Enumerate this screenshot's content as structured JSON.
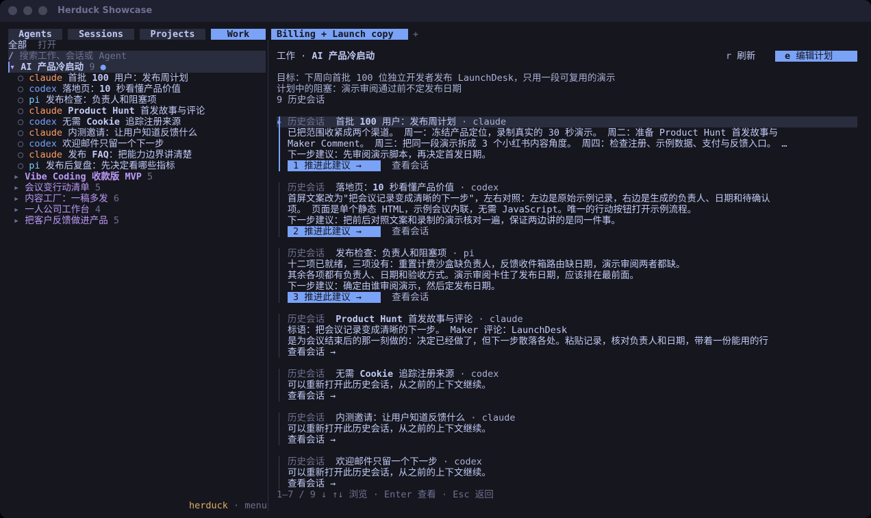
{
  "window": {
    "title": "Herduck Showcase"
  },
  "tabs": [
    {
      "label": "Agents",
      "active": false
    },
    {
      "label": "Sessions",
      "active": false
    },
    {
      "label": "Projects",
      "active": false
    },
    {
      "label": "Work",
      "active": true
    },
    {
      "label": "Billing + Launch copy",
      "active": true
    }
  ],
  "tab_add": "+",
  "sidebar": {
    "filter_all": "全部",
    "filter_open": "打开",
    "search_prefix": "/",
    "search_placeholder": "搜索工作、会话或 Agent",
    "active_project": {
      "arrow": "▾",
      "name": "AI 产品冷启动",
      "count": "9",
      "dot": "●"
    },
    "sessions": [
      {
        "bullet": "○",
        "agent": "claude",
        "pre": "首批 ",
        "bold": "100",
        "post": " 用户：发布周计划"
      },
      {
        "bullet": "○",
        "agent": "codex",
        "pre": "落地页：",
        "bold": "10",
        "post": " 秒看懂产品价值"
      },
      {
        "bullet": "○",
        "agent": "pi",
        "pre": "发布检查：负责人和阻塞项",
        "bold": "",
        "post": ""
      },
      {
        "bullet": "○",
        "agent": "claude",
        "pre": "",
        "bold": "Product Hunt",
        "post": " 首发故事与评论"
      },
      {
        "bullet": "○",
        "agent": "codex",
        "pre": "无需 ",
        "bold": "Cookie",
        "post": " 追踪注册来源"
      },
      {
        "bullet": "○",
        "agent": "claude",
        "pre": "内测邀请：让用户知道反馈什么",
        "bold": "",
        "post": ""
      },
      {
        "bullet": "○",
        "agent": "codex",
        "pre": "欢迎邮件只留一个下一步",
        "bold": "",
        "post": ""
      },
      {
        "bullet": "○",
        "agent": "claude",
        "pre": "发布 ",
        "bold": "FAQ",
        "post": "：把能力边界讲清楚"
      },
      {
        "bullet": "○",
        "agent": "pi",
        "pre": "发布后复盘：先决定看哪些指标",
        "bold": "",
        "post": ""
      }
    ],
    "projects": [
      {
        "arrow": "▸",
        "pre": "Vibe Coding 收款版 ",
        "bold": "MVP",
        "count": "5"
      },
      {
        "arrow": "▸",
        "pre": "会议变行动清单",
        "bold": "",
        "count": "5"
      },
      {
        "arrow": "▸",
        "pre": "内容工厂：一稿多发",
        "bold": "",
        "count": "6"
      },
      {
        "arrow": "▸",
        "pre": "一人公司工作台",
        "bold": "",
        "count": "4"
      },
      {
        "arrow": "▸",
        "pre": "把客户反馈做进产品",
        "bold": "",
        "count": "5"
      }
    ],
    "footer_brand": "herduck",
    "footer_sep": "·",
    "footer_menu": "menu"
  },
  "main": {
    "header_prefix": "工作 · ",
    "header_project": "AI 产品冷启动",
    "refresh_key": "r",
    "refresh_label": "刷新",
    "edit_key": "e",
    "edit_label": "编辑计划",
    "goal": "目标：下周向首批 100 位独立开发者发布 LaunchDesk，只用一段可复用的演示",
    "blocker": "计划中的阻塞：演示审阅通过前不定发布日期",
    "history_count": "9 历史会话",
    "cards": [
      {
        "tag": "历史会话",
        "title_pre": "首批 ",
        "title_bold": "100",
        "title_post": " 用户：发布周计划",
        "agent": "claude",
        "lines": [
          "已把范围收紧成两个渠道。 周一：冻结产品定位，录制真实的 30 秒演示。 周二：准备 Product Hunt 首发故事与",
          "Maker Comment。 周三：把同一段演示拆成 3 个小红书内容角度。 周四：检查注册、示例数据、支付与反馈入口。 …",
          "下一步建议：先审阅演示脚本，再决定首发日期。"
        ],
        "advance_label": "1 推进此建议 →",
        "view_label": "查看会话"
      },
      {
        "tag": "历史会话",
        "title_pre": "落地页：",
        "title_bold": "10",
        "title_post": " 秒看懂产品价值",
        "agent": "codex",
        "lines": [
          "首屏文案改为\"把会议记录变成清晰的下一步\"，左右对照：左边是原始示例记录，右边是生成的负责人、日期和待确认",
          "项。 页面是单个静态 HTML，示例会议内联，无需 JavaScript。唯一的行动按钮打开示例流程。",
          "下一步建议：把前后对照文案和录制的演示核对一遍，保证两边讲的是同一件事。"
        ],
        "advance_label": "2 推进此建议 →",
        "view_label": "查看会话"
      },
      {
        "tag": "历史会话",
        "title_pre": "发布检查：负责人和阻塞项",
        "title_bold": "",
        "title_post": "",
        "agent": "pi",
        "lines": [
          "十二项已就绪，三项没有：重置计费沙盒缺负责人，反馈收件箱路由缺日期，演示审阅两者都缺。",
          "其余各项都有负责人、日期和验收方式。演示审阅卡住了发布日期，应该排在最前面。",
          "下一步建议：确定由谁审阅演示，然后定发布日期。"
        ],
        "advance_label": "3 推进此建议 →",
        "view_label": "查看会话"
      },
      {
        "tag": "历史会话",
        "title_pre": "",
        "title_bold": "Product Hunt",
        "title_post": " 首发故事与评论",
        "agent": "claude",
        "lines": [
          "标语：把会议记录变成清晰的下一步。 Maker 评论：LaunchDesk",
          "是为会议结束后的那一刻做的：决定已经做了，但下一步散落各处。粘贴记录，核对负责人和日期，带着一份能用的行"
        ],
        "advance_label": "",
        "view_label": "查看会话 →"
      },
      {
        "tag": "历史会话",
        "title_pre": "无需 ",
        "title_bold": "Cookie",
        "title_post": " 追踪注册来源",
        "agent": "codex",
        "lines": [
          "可以重新打开此历史会话，从之前的上下文继续。"
        ],
        "advance_label": "",
        "view_label": "查看会话 →"
      },
      {
        "tag": "历史会话",
        "title_pre": "内测邀请：让用户知道反馈什么",
        "title_bold": "",
        "title_post": "",
        "agent": "claude",
        "lines": [
          "可以重新打开此历史会话，从之前的上下文继续。"
        ],
        "advance_label": "",
        "view_label": "查看会话 →"
      },
      {
        "tag": "历史会话",
        "title_pre": "欢迎邮件只留一个下一步",
        "title_bold": "",
        "title_post": "",
        "agent": "codex",
        "lines": [
          "可以重新打开此历史会话，从之前的上下文继续。"
        ],
        "advance_label": "",
        "view_label": "查看会话 →"
      }
    ],
    "selected_marker": "▸",
    "agent_sep": "·",
    "status_bar": "1–7 / 9 ↓  ↑↓ 浏览 · Enter 查看 · Esc 返回"
  },
  "colors": {
    "background": "#16161e",
    "accent": "#7aa2f7",
    "claude": "#ff9e64",
    "codex": "#7aa2f7",
    "pi": "#7dcfff",
    "project": "#bb9af7"
  }
}
